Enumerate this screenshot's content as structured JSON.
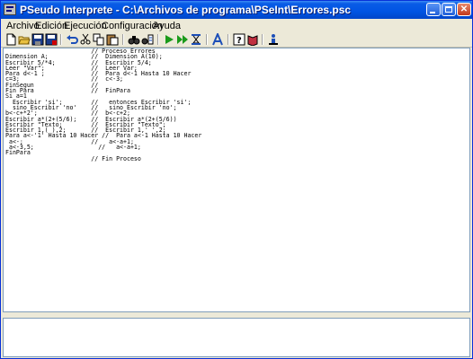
{
  "window": {
    "title": "PSeudo Interprete - C:\\Archivos de programa\\PSeInt\\Errores.psc"
  },
  "menu": [
    "Archivo",
    "Edición",
    "Ejecución",
    "Configuración",
    "Ayuda"
  ],
  "toolbar": {
    "icons": [
      "new-file-icon",
      "open-folder-icon",
      "save-icon",
      "save-as-icon",
      "undo-icon",
      "cut-icon",
      "copy-icon",
      "paste-icon",
      "find-icon",
      "replace-icon",
      "run-icon",
      "step-run-icon",
      "debug-icon",
      "font-icon",
      "help-icon",
      "book-icon",
      "about-icon"
    ]
  },
  "editor": {
    "code": "                        // Proceso Errores\nDimension A;            //  Dimension A(10);\nEscribir 5/*4;          //  Escribir 5/4;\nLeer \"Var\";             //  Leer Var;\nPara d<-1 ;             //  Para d<-1 Hasta 10 Hacer\nc=3;                    //  c<-3;\nFinSegun                //\nFin Para                //  FinPara\nSi a=1\n  Escribir 'si';        //   entonces Escribir 'si';\n  sino Escribir 'no'    //   sino Escribir 'no';\nb<-c+*2';               //  b<-c+2;\nEscribir a*(2+(5/6);    //  Escribir a*(2+(5/6))\nEscribir \"Texto;        //  Escribir \"Texto\";\nEscribir 1,( ),2;       //  Escribir 1,' ',2;\nPara a<-'1' Hasta 10 Hacer //  Para a<-1 Hasta 10 Hacer\n a<-;                   //   a<-a+1;\n a<-3,5;                  //   a<-a+1;\nFinPara\n                        // Fin Proceso"
  },
  "output": {
    "text": ""
  }
}
